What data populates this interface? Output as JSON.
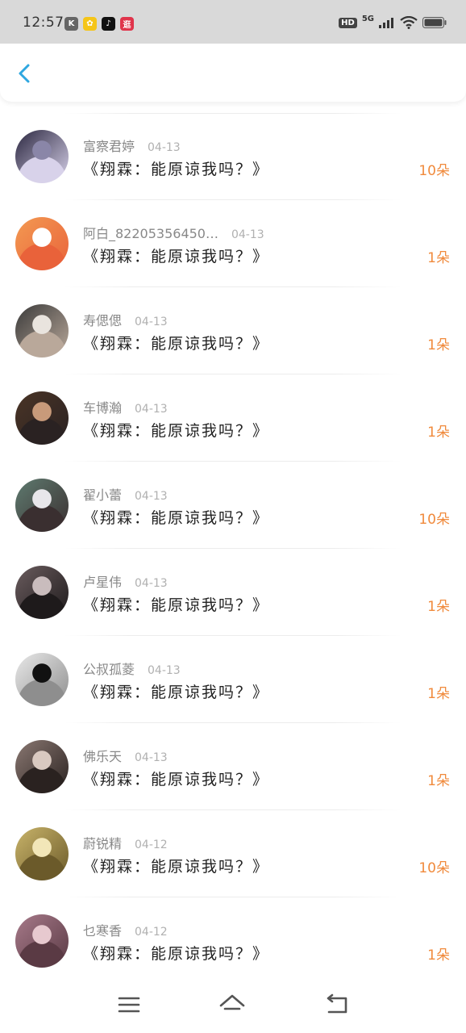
{
  "status_bar": {
    "time": "12:57",
    "apps": [
      {
        "icon": "k-app-icon",
        "color": "#666666",
        "glyph": "K"
      },
      {
        "icon": "flower-app-icon",
        "color": "#f5c518",
        "glyph": "✿"
      },
      {
        "icon": "tiktok-app-icon",
        "color": "#111111",
        "glyph": "♪"
      },
      {
        "icon": "red-app-icon",
        "color": "#e0344b",
        "glyph": "逛"
      }
    ],
    "hd": "HD",
    "network": "5G"
  },
  "header": {
    "back_icon": "chevron-left-icon",
    "accent": "#2ea7e0"
  },
  "gifts": [
    {
      "name": "富察君婷",
      "date": "04-13",
      "message": "《翔霖：能原谅我吗？》",
      "count": "10朵",
      "avatar_colors": [
        "#2b2740",
        "#8a86a8",
        "#d8d2ea"
      ]
    },
    {
      "name": "阿白_82205356450…",
      "date": "04-13",
      "message": "《翔霖：能原谅我吗？》",
      "count": "1朵",
      "avatar_colors": [
        "#f39a52",
        "#ffffff",
        "#e9623a"
      ]
    },
    {
      "name": "寿偲偲",
      "date": "04-13",
      "message": "《翔霖：能原谅我吗？》",
      "count": "1朵",
      "avatar_colors": [
        "#3a3a3a",
        "#e9e4de",
        "#b9a89a"
      ]
    },
    {
      "name": "车博瀚",
      "date": "04-13",
      "message": "《翔霖：能原谅我吗？》",
      "count": "1朵",
      "avatar_colors": [
        "#4a3426",
        "#c89a7a",
        "#2a2222"
      ]
    },
    {
      "name": "翟小蕾",
      "date": "04-13",
      "message": "《翔霖：能原谅我吗？》",
      "count": "10朵",
      "avatar_colors": [
        "#5f7b70",
        "#e8e6ea",
        "#3a2f30"
      ]
    },
    {
      "name": "卢星伟",
      "date": "04-13",
      "message": "《翔霖：能原谅我吗？》",
      "count": "1朵",
      "avatar_colors": [
        "#6a5c5e",
        "#c9bcbd",
        "#1e1a1b"
      ]
    },
    {
      "name": "公叔孤菱",
      "date": "04-13",
      "message": "《翔霖：能原谅我吗？》",
      "count": "1朵",
      "avatar_colors": [
        "#e9e9e9",
        "#111111",
        "#8e8e8e"
      ]
    },
    {
      "name": "佛乐天",
      "date": "04-13",
      "message": "《翔霖：能原谅我吗？》",
      "count": "1朵",
      "avatar_colors": [
        "#8a7872",
        "#d9c9c0",
        "#2a2220"
      ]
    },
    {
      "name": "蔚锐精",
      "date": "04-12",
      "message": "《翔霖：能原谅我吗？》",
      "count": "10朵",
      "avatar_colors": [
        "#c9b46a",
        "#f2e6b8",
        "#6b5a2a"
      ]
    },
    {
      "name": "乜寒香",
      "date": "04-12",
      "message": "《翔霖：能原谅我吗？》",
      "count": "1朵",
      "avatar_colors": [
        "#a77a8a",
        "#e7c9cf",
        "#5a3a44"
      ]
    }
  ],
  "nav_bar": {
    "menu_icon": "menu-icon",
    "home_icon": "home-icon",
    "back_icon": "back-icon"
  }
}
